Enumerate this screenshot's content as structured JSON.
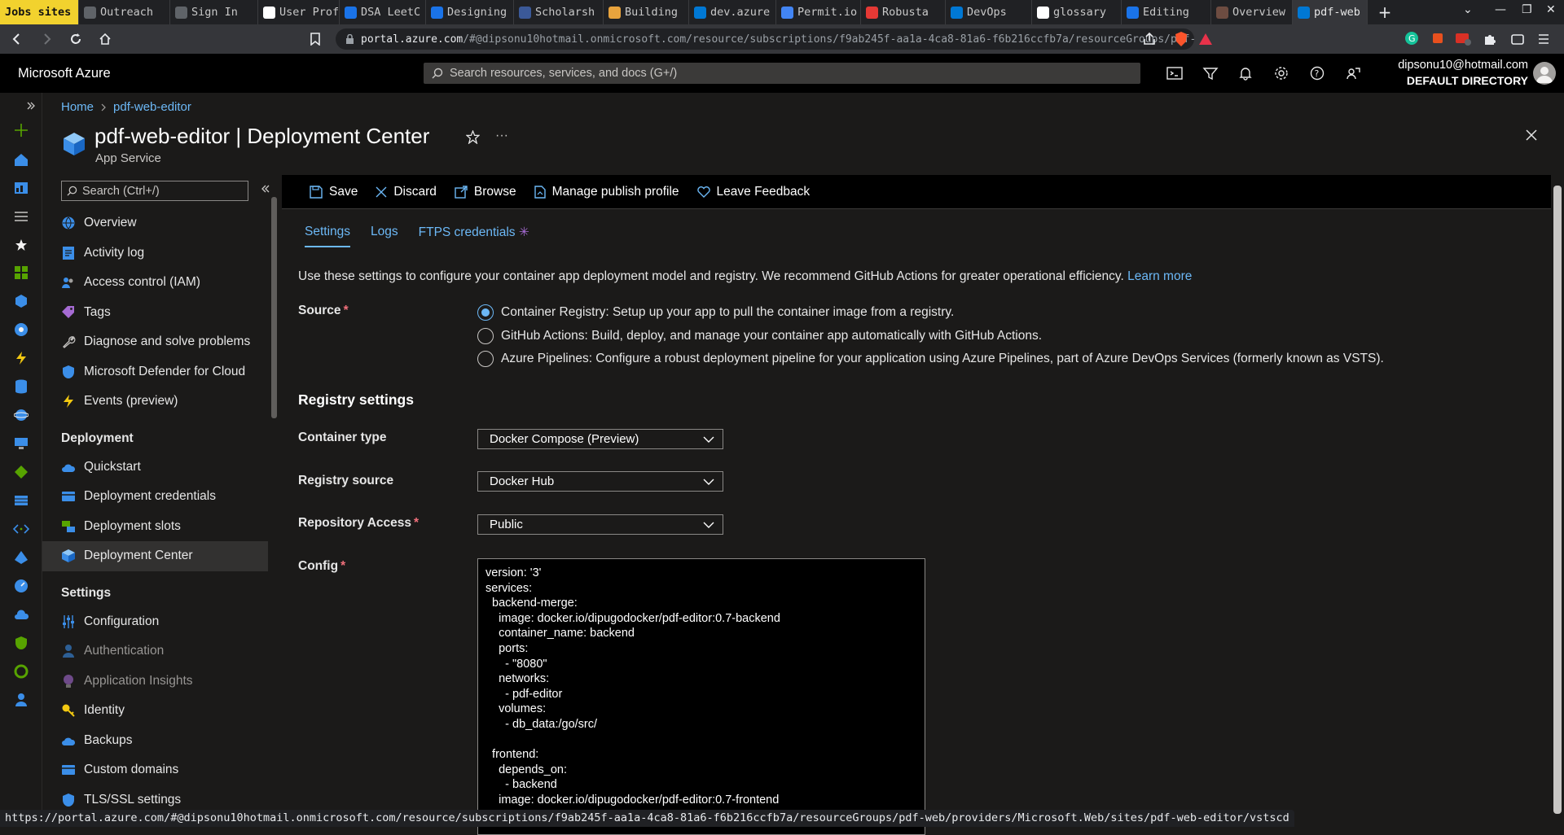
{
  "browser": {
    "tabs": [
      {
        "label": "Jobs sites",
        "color": "#f2d22e"
      },
      {
        "label": "Outreach",
        "color": "#5f6368"
      },
      {
        "label": "Sign In",
        "color": "#5f6368"
      },
      {
        "label": "User Prof",
        "color": "#ffffff"
      },
      {
        "label": "DSA LeetC",
        "color": "#1a73e8"
      },
      {
        "label": "Designing",
        "color": "#1a73e8"
      },
      {
        "label": "Scholarsh",
        "color": "#3b5998"
      },
      {
        "label": "Building",
        "color": "#e8a33d"
      },
      {
        "label": "dev.azure",
        "color": "#0078d4"
      },
      {
        "label": "Permit.io",
        "color": "#4285f4"
      },
      {
        "label": "Robusta",
        "color": "#e53935"
      },
      {
        "label": "DevOps",
        "color": "#0078d4"
      },
      {
        "label": "glossary",
        "color": "#ffffff"
      },
      {
        "label": "Editing",
        "color": "#1a73e8"
      },
      {
        "label": "Overview",
        "color": "#6d4c41"
      },
      {
        "label": "pdf-web",
        "color": "#0078d4"
      }
    ],
    "url_host": "portal.azure.com",
    "url_path": "/#@dipsonu10hotmail.onmicrosoft.com/resource/subscriptions/f9ab245f-aa1a-4ca8-81a6-f6b216ccfb7a/resourceGroups/pdf-w...",
    "status_url": "https://portal.azure.com/#@dipsonu10hotmail.onmicrosoft.com/resource/subscriptions/f9ab245f-aa1a-4ca8-81a6-f6b216ccfb7a/resourceGroups/pdf-web/providers/Microsoft.Web/sites/pdf-web-editor/vstscd"
  },
  "azure": {
    "brand": "Microsoft Azure",
    "search_placeholder": "Search resources, services, and docs (G+/)",
    "account_email": "dipsonu10@hotmail.com",
    "account_directory": "DEFAULT DIRECTORY"
  },
  "header": {
    "breadcrumb_home": "Home",
    "breadcrumb_resource": "pdf-web-editor",
    "title": "pdf-web-editor | Deployment Center",
    "subtitle": "App Service"
  },
  "sidebar": {
    "search_placeholder": "Search (Ctrl+/)",
    "items": [
      {
        "label": "Overview",
        "icon": "globe-icon",
        "color": "#3b8ee8"
      },
      {
        "label": "Activity log",
        "icon": "log-icon",
        "color": "#3b8ee8"
      },
      {
        "label": "Access control (IAM)",
        "icon": "people-icon",
        "color": "#3b8ee8"
      },
      {
        "label": "Tags",
        "icon": "tag-icon",
        "color": "#a66bd3"
      },
      {
        "label": "Diagnose and solve problems",
        "icon": "wrench-icon",
        "color": "#c8c6c4"
      },
      {
        "label": "Microsoft Defender for Cloud",
        "icon": "shield-icon",
        "color": "#3b8ee8"
      },
      {
        "label": "Events (preview)",
        "icon": "bolt-icon",
        "color": "#f2c811"
      }
    ],
    "deployment_heading": "Deployment",
    "deployment_items": [
      {
        "label": "Quickstart",
        "icon": "cloud-icon",
        "color": "#3b8ee8"
      },
      {
        "label": "Deployment credentials",
        "icon": "card-icon",
        "color": "#3b8ee8"
      },
      {
        "label": "Deployment slots",
        "icon": "slots-icon",
        "color": "#57a300"
      },
      {
        "label": "Deployment Center",
        "icon": "cube-icon",
        "color": "#3b8ee8"
      }
    ],
    "settings_heading": "Settings",
    "settings_items": [
      {
        "label": "Configuration",
        "icon": "sliders-icon",
        "color": "#3b8ee8"
      },
      {
        "label": "Authentication",
        "icon": "person-icon",
        "color": "#3b8ee8"
      },
      {
        "label": "Application Insights",
        "icon": "bulb-icon",
        "color": "#a66bd3"
      },
      {
        "label": "Identity",
        "icon": "key-icon",
        "color": "#f2c811"
      },
      {
        "label": "Backups",
        "icon": "cloud-icon",
        "color": "#3b8ee8"
      },
      {
        "label": "Custom domains",
        "icon": "card-icon",
        "color": "#3b8ee8"
      },
      {
        "label": "TLS/SSL settings",
        "icon": "shield-icon",
        "color": "#3b8ee8"
      }
    ]
  },
  "commands": {
    "save": "Save",
    "discard": "Discard",
    "browse": "Browse",
    "manage_publish_profile": "Manage publish profile",
    "leave_feedback": "Leave Feedback"
  },
  "tabs": {
    "settings": "Settings",
    "logs": "Logs",
    "ftps": "FTPS credentials"
  },
  "intro": {
    "text": "Use these settings to configure your container app deployment model and registry. We recommend GitHub Actions for greater operational efficiency. ",
    "link": "Learn more"
  },
  "source": {
    "label": "Source",
    "options": [
      "Container Registry: Setup up your app to pull the container image from a registry.",
      "GitHub Actions: Build, deploy, and manage your container app automatically with GitHub Actions.",
      "Azure Pipelines: Configure a robust deployment pipeline for your application using Azure Pipelines, part of Azure DevOps Services (formerly known as VSTS)."
    ]
  },
  "registry": {
    "heading": "Registry settings",
    "container_type_label": "Container type",
    "container_type_value": "Docker Compose (Preview)",
    "registry_source_label": "Registry source",
    "registry_source_value": "Docker Hub",
    "repository_access_label": "Repository Access",
    "repository_access_value": "Public",
    "config_label": "Config",
    "config_value": "version: '3'\nservices:\n  backend-merge:\n    image: docker.io/dipugodocker/pdf-editor:0.7-backend\n    container_name: backend\n    ports:\n      - \"8080\"\n    networks:\n      - pdf-editor\n    volumes:\n      - db_data:/go/src/\n\n  frontend:\n    depends_on:\n      - backend\n    image: docker.io/dipugodocker/pdf-editor:0.7-frontend"
  }
}
